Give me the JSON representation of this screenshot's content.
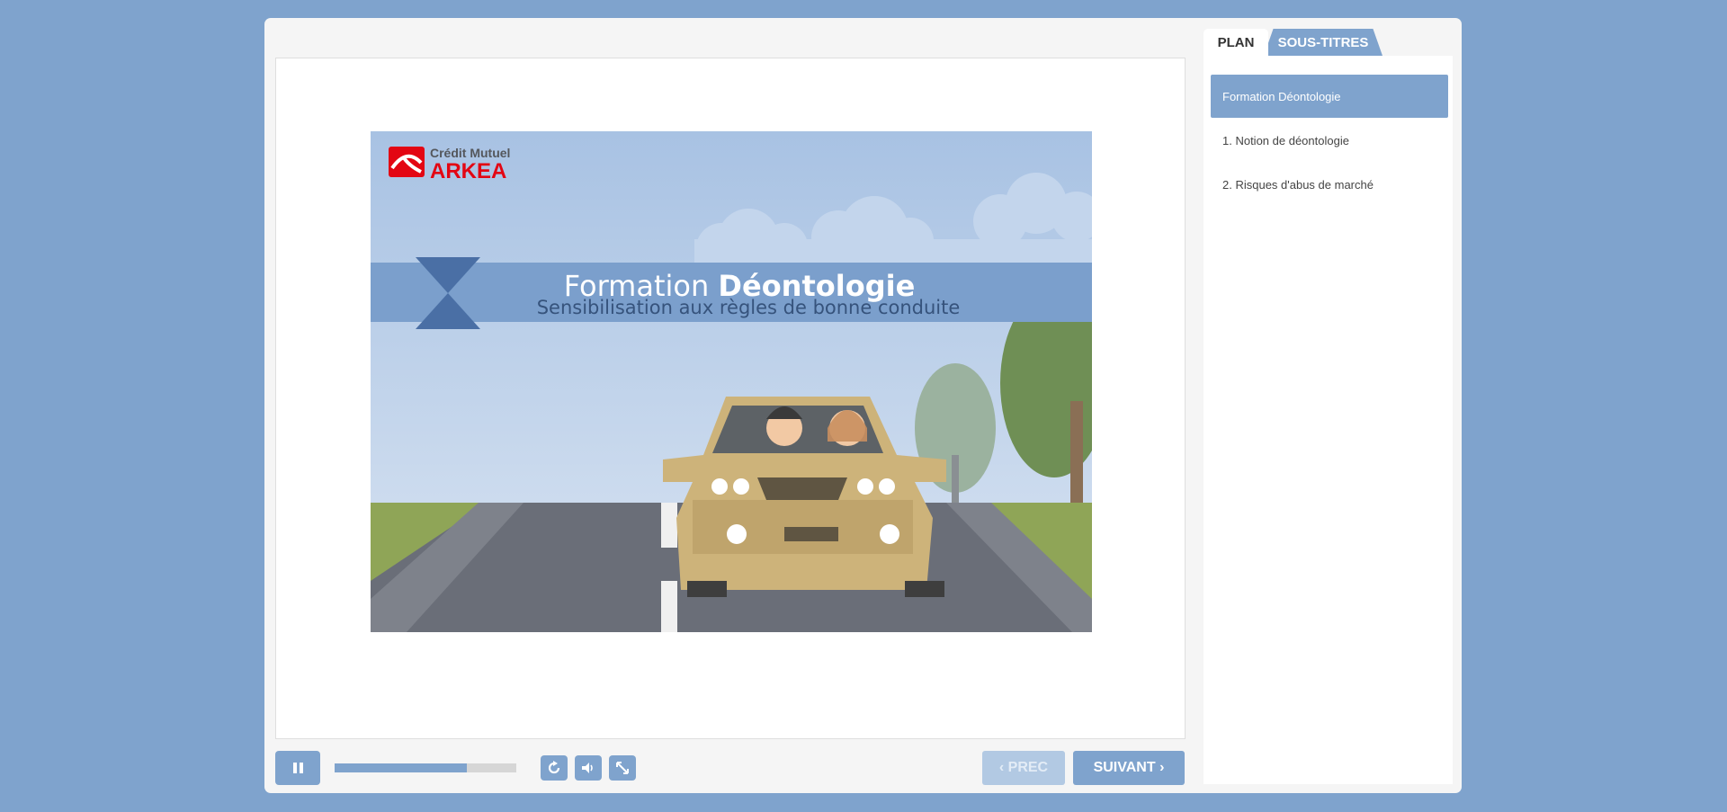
{
  "player": {
    "controls": {
      "pause_icon": "pause-icon",
      "progress_fraction": 0.73,
      "replay_icon": "replay-icon",
      "volume_icon": "volume-icon",
      "fullscreen_icon": "fullscreen-icon",
      "prev_label": "PREC",
      "next_label": "SUIVANT"
    }
  },
  "slide": {
    "logo_line1": "Crédit Mutuel",
    "logo_line2": "ARKEA",
    "title_light": "Formation ",
    "title_bold": "Déontologie",
    "subtitle": "Sensibilisation aux règles de bonne conduite"
  },
  "sidebar": {
    "tabs": [
      {
        "label": "PLAN",
        "active": true
      },
      {
        "label": "SOUS-TITRES",
        "active": false
      }
    ],
    "items": [
      {
        "label": "Formation Déontologie",
        "active": true
      },
      {
        "label": "1. Notion de déontologie",
        "active": false
      },
      {
        "label": "2. Risques d'abus de marché",
        "active": false
      }
    ]
  },
  "colors": {
    "page_background": "#7fa3cd",
    "accent": "#7fa3cd",
    "banner": "#7b9fcc",
    "logo_red": "#e30613",
    "car": "#cdb37a"
  }
}
